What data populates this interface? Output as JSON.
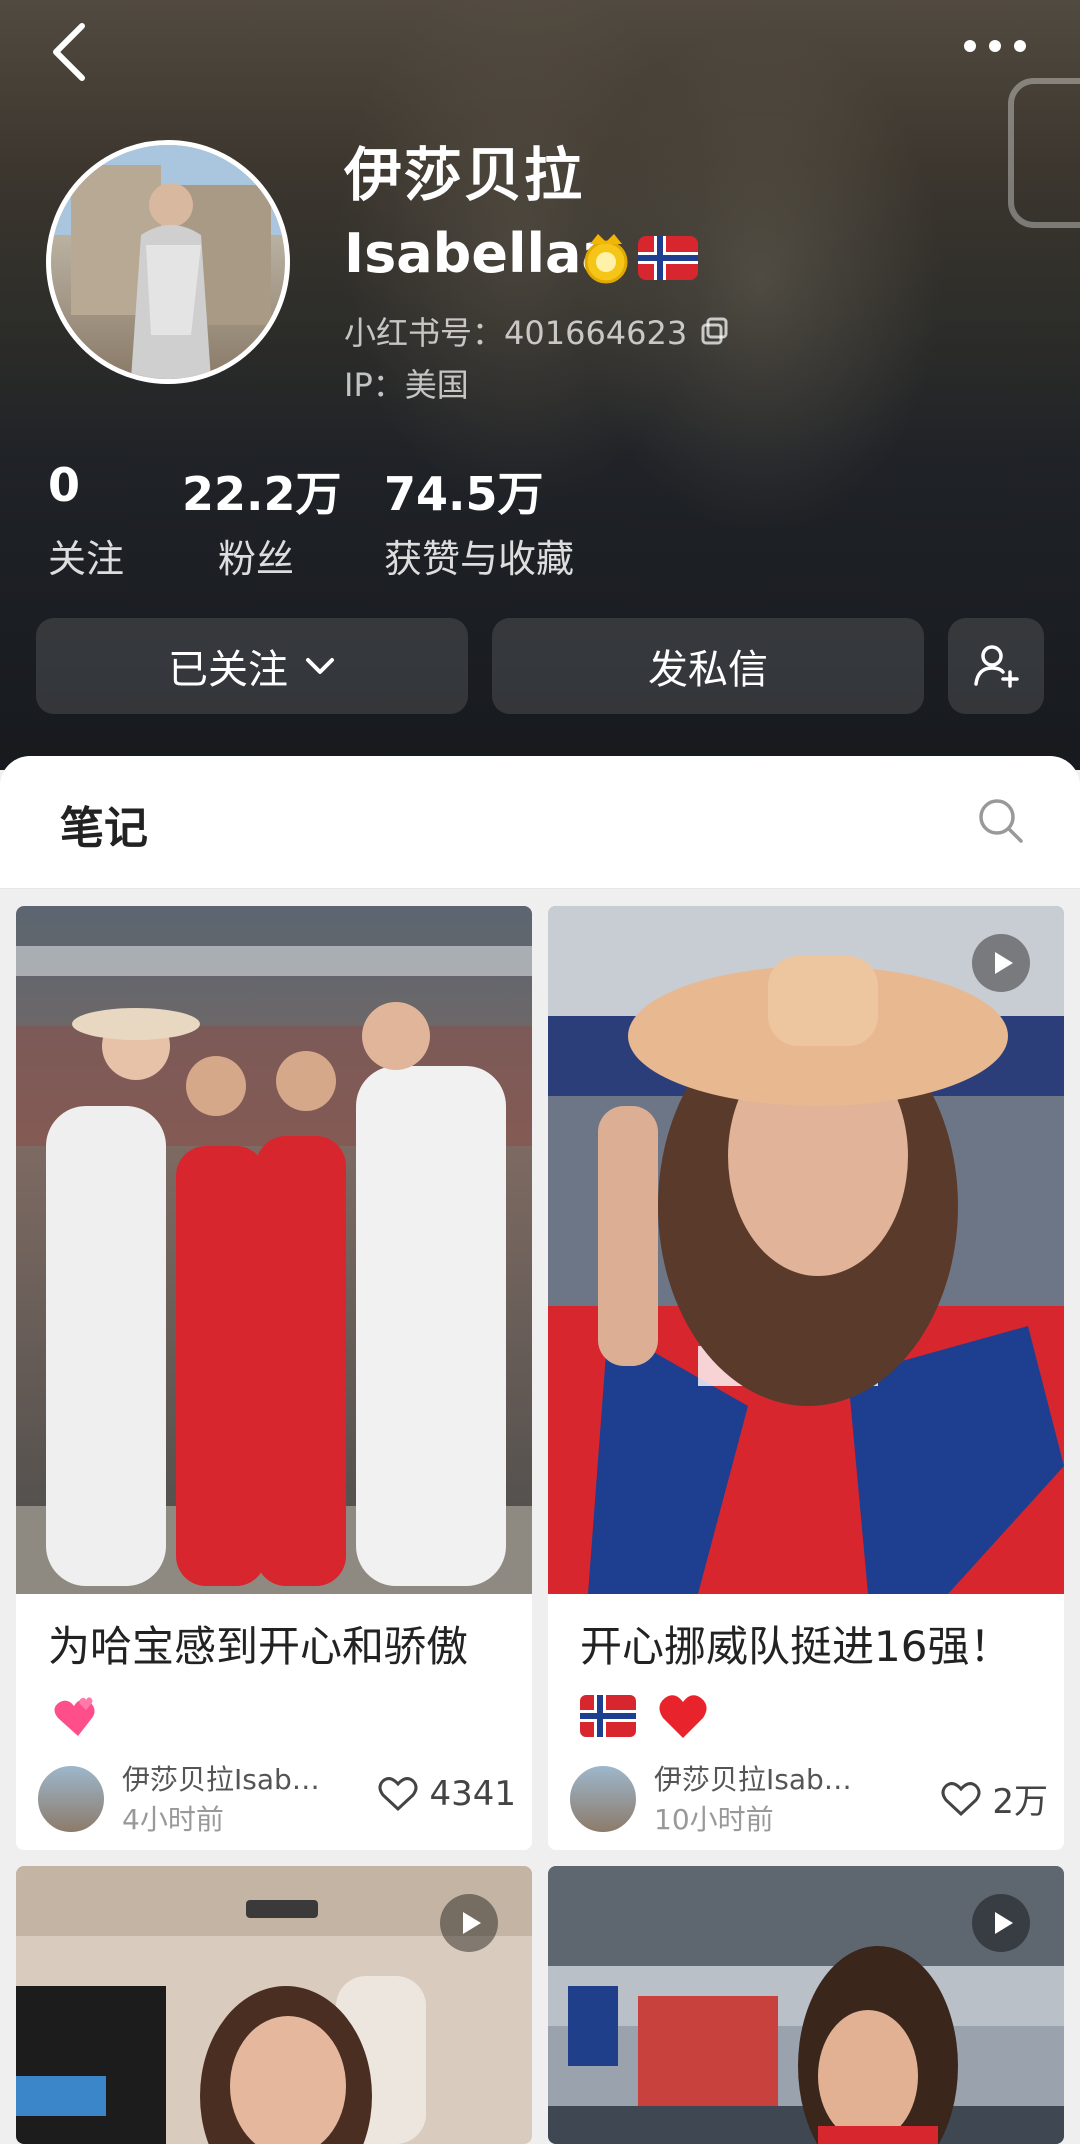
{
  "profile": {
    "name_cn": "伊莎贝拉",
    "name_en": "Isabellaa",
    "red_id": "小红书号：401664623",
    "ip": "IP：美国",
    "badge_icons": [
      "crown-medal-icon",
      "norway-flag-icon"
    ]
  },
  "stats": [
    {
      "value": "0",
      "label": "关注"
    },
    {
      "value": "22.2万",
      "label": "粉丝"
    },
    {
      "value": "74.5万",
      "label": "获赞与收藏"
    }
  ],
  "actions": {
    "follow": "已关注",
    "message": "发私信",
    "add_friend_icon": "add-user-icon"
  },
  "tabs": {
    "notes": "笔记"
  },
  "posts": [
    {
      "title": "为哈宝感到开心和骄傲",
      "emoji": [
        "two-hearts-icon"
      ],
      "author": "伊莎贝拉Isab…",
      "time": "4小时前",
      "likes": "4341",
      "video": false
    },
    {
      "title": "开心挪威队挺进16强！",
      "emoji": [
        "norway-flag-icon",
        "red-heart-icon"
      ],
      "author": "伊莎贝拉Isab…",
      "time": "10小时前",
      "likes": "2万",
      "video": true
    },
    {
      "video": true
    },
    {
      "video": true
    }
  ],
  "colors": {
    "header_dark": "#23272e",
    "panel_bg": "#ffffff",
    "feed_bg": "#efefef",
    "norway_red": "#d8262f",
    "norway_blue": "#1e3f8f"
  }
}
